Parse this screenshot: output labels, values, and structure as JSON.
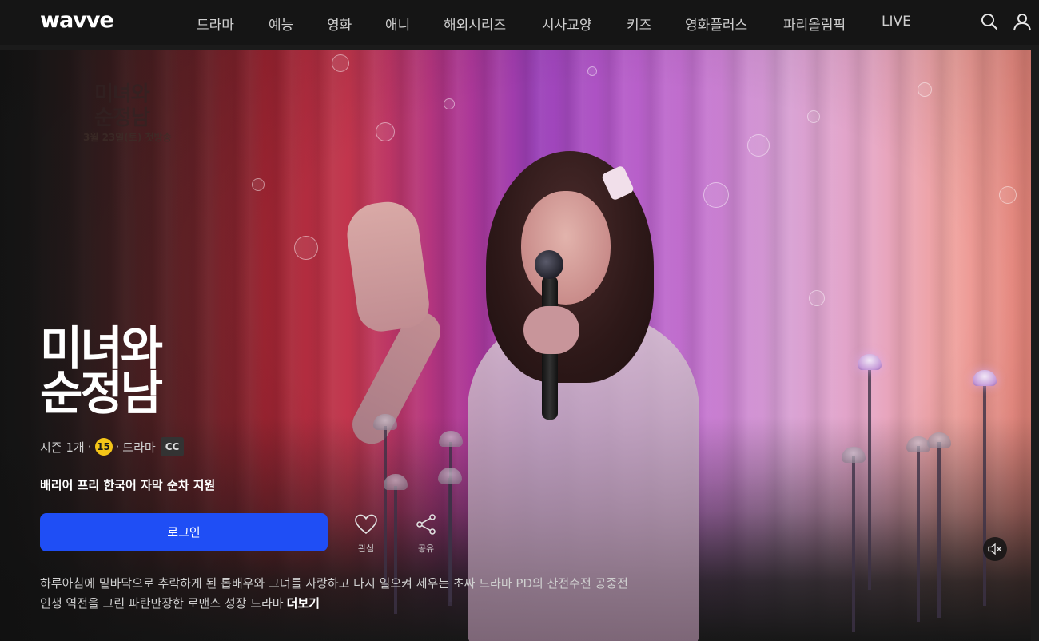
{
  "header": {
    "logo": "wavve",
    "nav": [
      "드라마",
      "예능",
      "영화",
      "애니",
      "해외시리즈",
      "시사교양",
      "키즈",
      "영화플러스",
      "파리올림픽",
      "LIVE"
    ],
    "icons": [
      "search-icon",
      "user-icon"
    ]
  },
  "hero": {
    "poster_title": "미녀와\n순정남",
    "poster_date": "3월 23일(토) 첫방송"
  },
  "content": {
    "title_logo_line1": "미녀와",
    "title_logo_line2": "순정남",
    "meta": {
      "seasons": "시즌 1개",
      "age_rating": "15",
      "genre": "드라마",
      "cc": "CC"
    },
    "barrier_free": "배리어 프리 한국어 자막 순차 지원",
    "login_label": "로그인",
    "actions": [
      {
        "label": "관심",
        "icon": "heart-icon"
      },
      {
        "label": "공유",
        "icon": "share-icon"
      }
    ],
    "description_line1": "하루아침에 밑바닥으로 추락하게 된 톱배우와 그녀를 사랑하고 다시 일으켜 세우는 초짜 드라마 PD의 산전수전 공중전",
    "description_line2": "인생 역전을 그린 파란만장한 로맨스 성장 드라마",
    "more_label": "더보기"
  },
  "colors": {
    "background": "#1b1b1b",
    "header": "#151515",
    "primary_button": "#1f4ef5",
    "age_badge": "#f5c518"
  }
}
